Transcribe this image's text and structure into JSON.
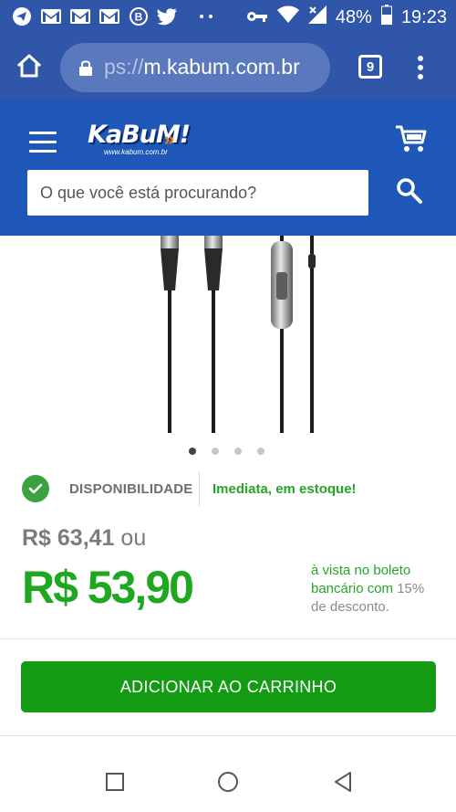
{
  "status_bar": {
    "battery": "48%",
    "time": "19:23",
    "notification_icons": [
      "telegram-icon",
      "gmail-icon",
      "gmail-icon",
      "gmail-icon",
      "bitcoin-icon",
      "twitter-icon",
      "more-dots-icon"
    ],
    "system_icons": [
      "key-icon",
      "wifi-icon",
      "signal-icon",
      "battery-icon"
    ]
  },
  "browser": {
    "url_prefix": "ps://",
    "url_host": "m.kabum.com.br",
    "tab_count": "9"
  },
  "header": {
    "logo_text": "KaBuM!",
    "logo_sub": "www.kabum.com.br",
    "search_placeholder": "O que você está procurando?"
  },
  "carousel": {
    "slide_count": 4,
    "active_index": 0
  },
  "availability": {
    "label": "DISPONIBILIDADE",
    "status": "Imediata, em estoque!"
  },
  "pricing": {
    "old_price": "R$ 63,41",
    "old_price_suffix": "ou",
    "new_price": "R$ 53,90",
    "note_green": "à vista no boleto bancário com",
    "note_percent": "15%",
    "note_end": "de desconto."
  },
  "actions": {
    "add_to_cart": "ADICIONAR AO CARRINHO"
  },
  "colors": {
    "header_blue": "#1f57b8",
    "status_blue": "#2f56a8",
    "price_green": "#1fa71f",
    "button_green": "#139c13"
  }
}
